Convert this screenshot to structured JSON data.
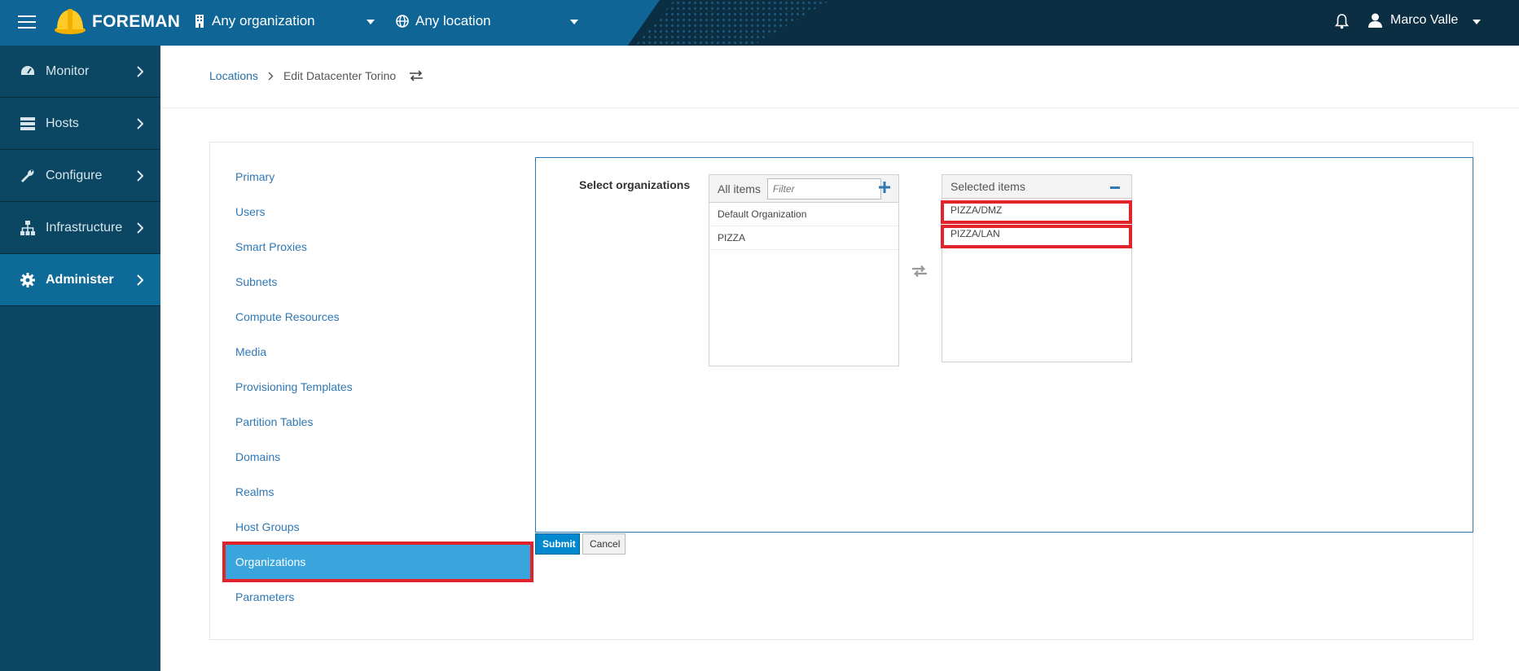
{
  "header": {
    "brand": "FOREMAN",
    "organization": "Any organization",
    "location": "Any location",
    "user": "Marco Valle",
    "colors": {
      "bar": "#0c2e42",
      "bar_left": "#0f6696"
    }
  },
  "sidebar": {
    "items": [
      {
        "label": "Monitor",
        "icon": "dashboard-icon"
      },
      {
        "label": "Hosts",
        "icon": "server-icon"
      },
      {
        "label": "Configure",
        "icon": "wrench-icon"
      },
      {
        "label": "Infrastructure",
        "icon": "network-icon"
      },
      {
        "label": "Administer",
        "icon": "gear-icon",
        "active": true
      }
    ]
  },
  "breadcrumb": {
    "parent": "Locations",
    "current": "Edit Datacenter Torino"
  },
  "tabs": [
    "Primary",
    "Users",
    "Smart Proxies",
    "Subnets",
    "Compute Resources",
    "Media",
    "Provisioning Templates",
    "Partition Tables",
    "Domains",
    "Realms",
    "Host Groups",
    "Organizations",
    "Parameters"
  ],
  "active_tab": "Organizations",
  "form": {
    "label": "Select organizations",
    "all_items": {
      "title": "All items",
      "filter_placeholder": "Filter",
      "items": [
        "Default Organization",
        "PIZZA"
      ]
    },
    "selected_items": {
      "title": "Selected items",
      "items": [
        "PIZZA/DMZ",
        "PIZZA/LAN"
      ]
    }
  },
  "buttons": {
    "submit": "Submit",
    "cancel": "Cancel"
  }
}
